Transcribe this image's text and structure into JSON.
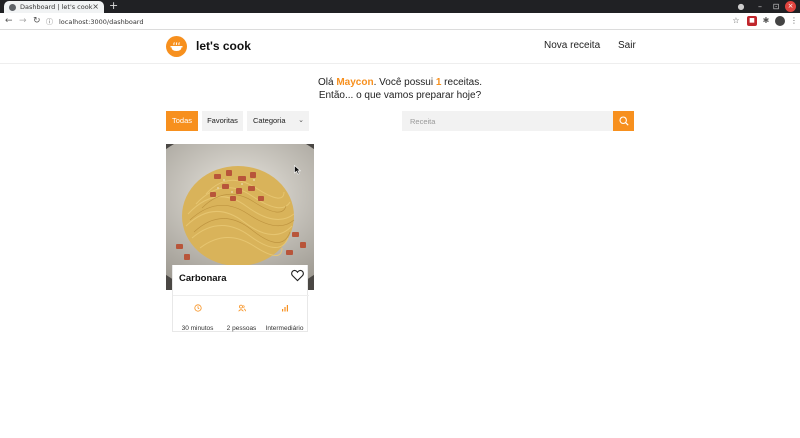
{
  "browser": {
    "tab_title": "Dashboard | let's cook",
    "tab_close": "×",
    "new_tab": "+",
    "url": "localhost:3000/dashboard"
  },
  "header": {
    "brand": "let's cook",
    "nav": {
      "new_recipe": "Nova receita",
      "logout": "Sair"
    }
  },
  "greeting": {
    "hello": "Olá ",
    "user": "Maycon",
    "mid": ". Você possui ",
    "count": "1",
    "suffix": " receitas.",
    "line2": "Então... o que vamos preparar hoje?"
  },
  "filters": {
    "all": "Todas",
    "favorites": "Favoritas",
    "category": "Categoria",
    "active": "Todas"
  },
  "search": {
    "placeholder": "Receita"
  },
  "recipes": [
    {
      "title": "Carbonara",
      "time": "30 minutos",
      "servings": "2 pessoas",
      "difficulty": "Intermediário",
      "favorited": false
    }
  ],
  "colors": {
    "accent": "#f7901e",
    "text": "#222222",
    "input_bg": "#f2f2f2"
  },
  "icons": {
    "logo": "cooking-pot-icon",
    "search": "search-icon",
    "favorite": "heart-icon",
    "time": "clock-icon",
    "servings": "users-icon",
    "difficulty": "bar-chart-icon",
    "category": "chevron-down-icon"
  }
}
